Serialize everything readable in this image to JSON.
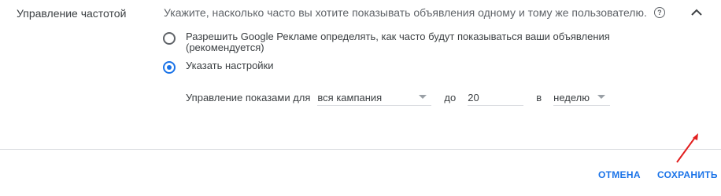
{
  "section": {
    "title": "Управление частотой",
    "description": "Укажите, насколько часто вы хотите показывать объявления одному и тому же пользователю."
  },
  "options": [
    {
      "label": "Разрешить Google Рекламе определять, как часто будут показываться ваши объявления",
      "sublabel": "(рекомендуется)",
      "checked": false
    },
    {
      "label": "Указать настройки",
      "checked": true
    }
  ],
  "controls": {
    "limit_label": "Управление показами для",
    "scope_value": "вся кампания",
    "to_label": "до",
    "count_value": "20",
    "per_label": "в",
    "period_value": "неделю"
  },
  "actions": {
    "cancel": "ОТМЕНА",
    "save": "СОХРАНИТЬ"
  },
  "colors": {
    "accent": "#1a73e8",
    "annotation_arrow": "#e21f1f"
  },
  "icons": [
    "help-icon",
    "chevron-up-icon",
    "arrow-annotation"
  ]
}
